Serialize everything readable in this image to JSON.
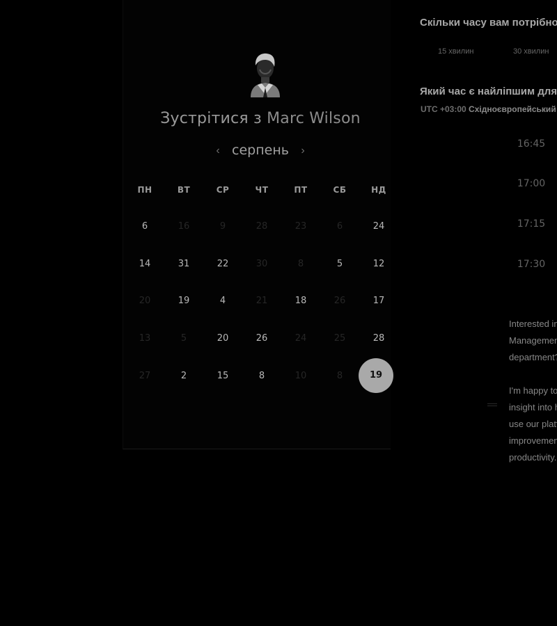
{
  "booking": {
    "title_prefix": "Зустрітися з",
    "host_name": "Marc Wilson",
    "month": "серпень",
    "prev_icon": "chevron-left-icon",
    "next_icon": "chevron-right-icon",
    "prev_glyph": "‹",
    "next_glyph": "›",
    "weekdays": [
      "ПН",
      "ВТ",
      "СР",
      "ЧТ",
      "ПТ",
      "СБ",
      "НД"
    ],
    "weeks": [
      [
        "6",
        "16",
        "9",
        "28",
        "23",
        "6",
        "24"
      ],
      [
        "14",
        "31",
        "22",
        "30",
        "8",
        "5",
        "12"
      ],
      [
        "20",
        "19",
        "4",
        "21",
        "18",
        "26",
        "17"
      ],
      [
        "13",
        "5",
        "20",
        "26",
        "24",
        "25",
        "28"
      ],
      [
        "27",
        "2",
        "15",
        "8",
        "10",
        "8",
        "19"
      ]
    ],
    "selected_day": "19",
    "colors": {
      "selected_bg": "#a9a9a9",
      "available": "#b9b9b9",
      "unavailable": "#262626"
    }
  },
  "duration": {
    "question": "Скільки часу вам потрібно?",
    "options": [
      "15 хвилин",
      "30 хвилин"
    ]
  },
  "time": {
    "question": "Який час є найліпшим для вас?",
    "tz_offset": "UTC +03:00",
    "tz_name": "Східноєвропейський час",
    "slots": [
      "16:45",
      "17:00",
      "17:15",
      "17:30"
    ]
  },
  "description": {
    "para1": [
      "Interested in Time",
      "Management for your",
      "department?"
    ],
    "para2": [
      "I'm happy to give you an",
      "insight into how you can",
      "use our platform for",
      "improvements in",
      "productivity."
    ]
  }
}
